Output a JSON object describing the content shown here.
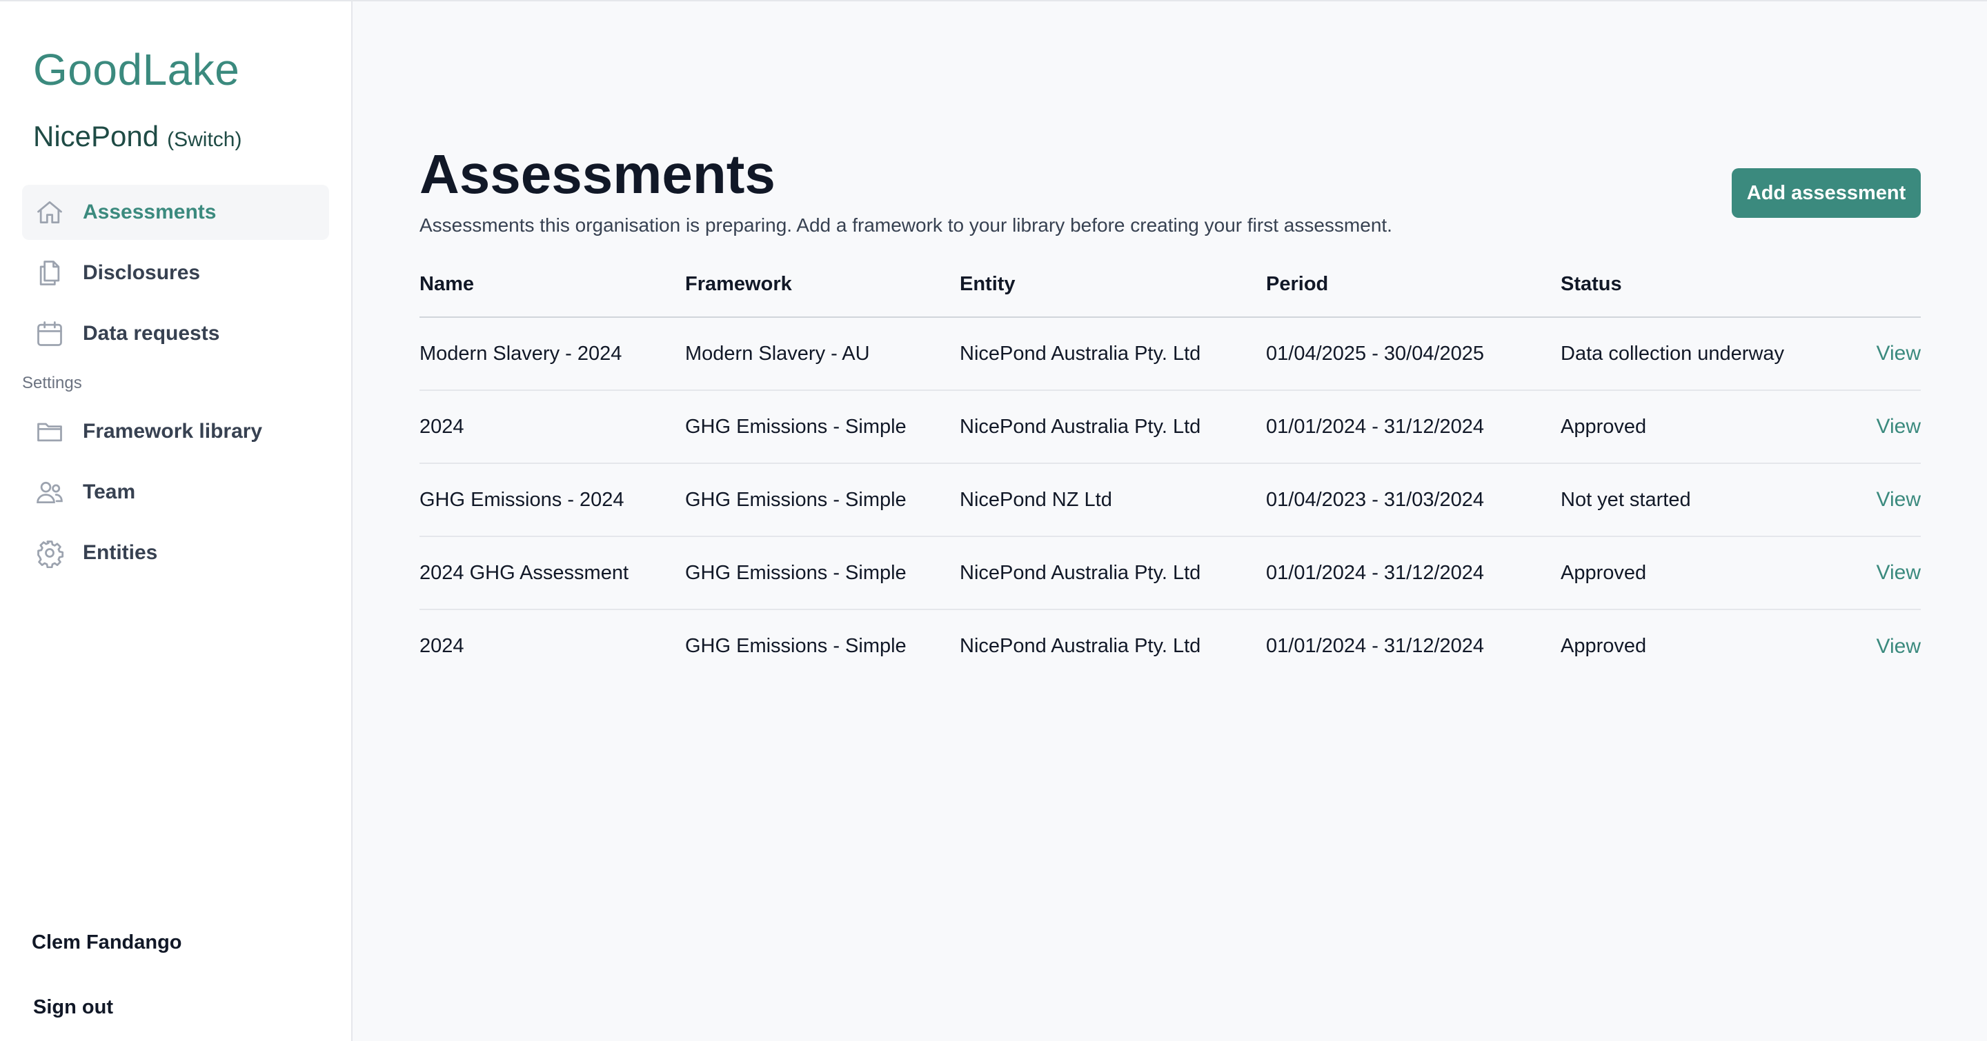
{
  "sidebar": {
    "brand": "GoodLake",
    "org_name": "NicePond",
    "org_switch": "(Switch)",
    "items": [
      {
        "label": "Assessments",
        "icon": "home-icon",
        "active": true
      },
      {
        "label": "Disclosures",
        "icon": "documents-icon"
      },
      {
        "label": "Data requests",
        "icon": "calendar-icon"
      }
    ],
    "settings_label": "Settings",
    "settings_items": [
      {
        "label": "Framework library",
        "icon": "folder-icon"
      },
      {
        "label": "Team",
        "icon": "users-icon"
      },
      {
        "label": "Entities",
        "icon": "gear-icon"
      }
    ],
    "user_name": "Clem Fandango",
    "sign_out": "Sign out"
  },
  "main": {
    "title": "Assessments",
    "subtitle": "Assessments this organisation is preparing. Add a framework to your library before creating your first assessment.",
    "add_button": "Add assessment",
    "table": {
      "headers": [
        "Name",
        "Framework",
        "Entity",
        "Period",
        "Status"
      ],
      "rows": [
        {
          "name": "Modern Slavery - 2024",
          "framework": "Modern Slavery - AU",
          "entity": "NicePond Australia Pty. Ltd",
          "period": "01/04/2025 - 30/04/2025",
          "status": "Data collection underway",
          "action": "View"
        },
        {
          "name": "2024",
          "framework": "GHG Emissions - Simple",
          "entity": "NicePond Australia Pty. Ltd",
          "period": "01/01/2024 - 31/12/2024",
          "status": "Approved",
          "action": "View"
        },
        {
          "name": "GHG Emissions - 2024",
          "framework": "GHG Emissions - Simple",
          "entity": "NicePond NZ Ltd",
          "period": "01/04/2023 - 31/03/2024",
          "status": "Not yet started",
          "action": "View"
        },
        {
          "name": "2024 GHG Assessment",
          "framework": "GHG Emissions - Simple",
          "entity": "NicePond Australia Pty. Ltd",
          "period": "01/01/2024 - 31/12/2024",
          "status": "Approved",
          "action": "View"
        },
        {
          "name": "2024",
          "framework": "GHG Emissions - Simple",
          "entity": "NicePond Australia Pty. Ltd",
          "period": "01/01/2024 - 31/12/2024",
          "status": "Approved",
          "action": "View"
        }
      ]
    }
  },
  "colors": {
    "accent": "#3b8a7e",
    "background": "#f8f9fb",
    "sidebar": "#ffffff"
  }
}
